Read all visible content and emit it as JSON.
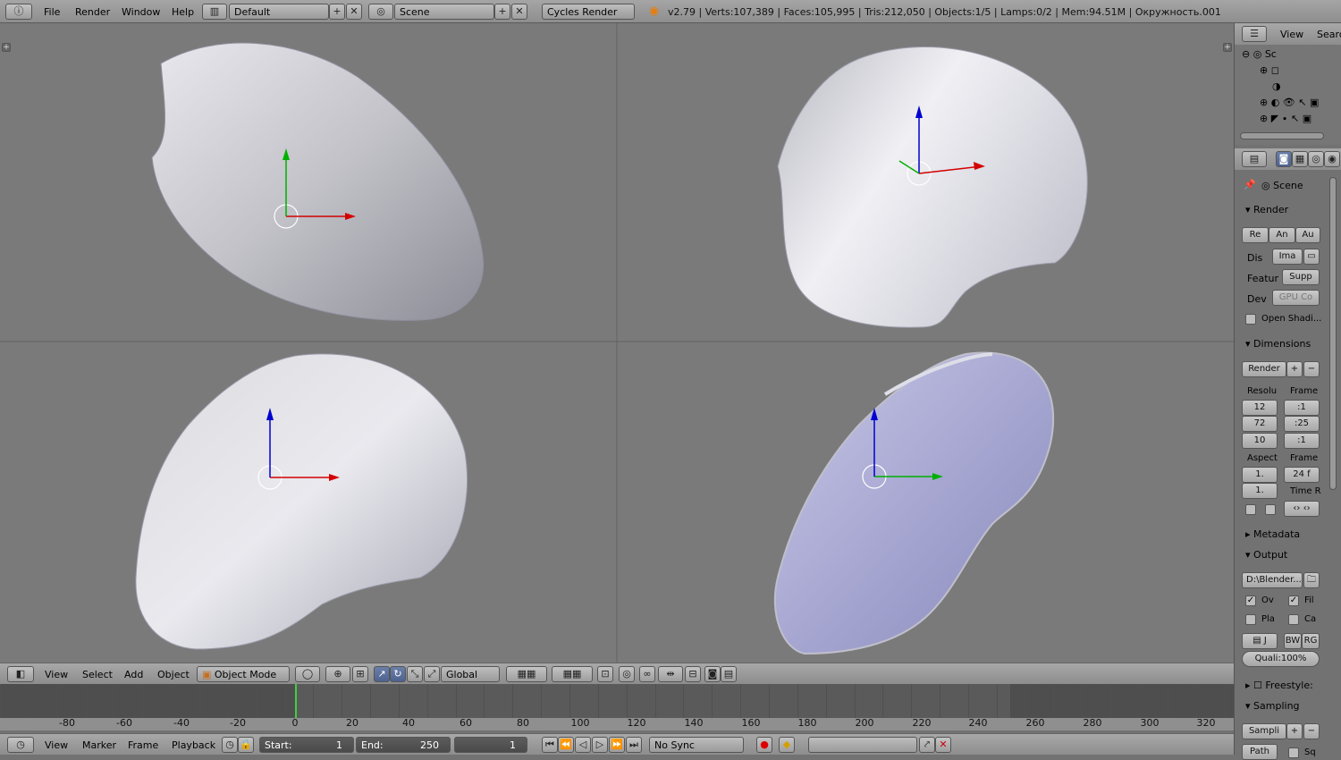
{
  "topbar": {
    "menus": [
      "File",
      "Render",
      "Window",
      "Help"
    ],
    "layout": "Default",
    "scene": "Scene",
    "engine": "Cycles Render",
    "info": "v2.79 | Verts:107,389 | Faces:105,995 | Tris:212,050 | Objects:1/5 | Lamps:0/2 | Mem:94.51M | Окружность.001"
  },
  "view3d_header": {
    "menus": [
      "View",
      "Select",
      "Add",
      "Object"
    ],
    "mode": "Object Mode",
    "orientation": "Global"
  },
  "timeline": {
    "labels": [
      "-80",
      "-60",
      "-40",
      "-20",
      "0",
      "20",
      "40",
      "60",
      "80",
      "100",
      "120",
      "140",
      "160",
      "180",
      "200",
      "220",
      "240",
      "260",
      "280",
      "300",
      "320"
    ],
    "current_frame_label": "0"
  },
  "timeline_header": {
    "menus": [
      "View",
      "Marker",
      "Frame",
      "Playback"
    ],
    "start_label": "Start:",
    "start_value": "1",
    "end_label": "End:",
    "end_value": "250",
    "current": "1",
    "sync": "No Sync"
  },
  "outliner": {
    "view": "View",
    "search": "Searc",
    "scene_short": "Sc"
  },
  "properties": {
    "scene": "Scene",
    "render_panel": "Render",
    "render_btns": [
      "Re",
      "An",
      "Au"
    ],
    "display_label": "Dis",
    "display_value": "Ima",
    "feature_label": "Featur",
    "feature_value": "Supp",
    "device_label": "Dev",
    "device_value": "GPU Co",
    "osl": "Open Shadi...",
    "dimensions": "Dimensions",
    "dim_preset": "Render",
    "resolution": "Resolu",
    "frame_range": "Frame",
    "res_x": "12",
    "res_y": "72",
    "res_pct": "10",
    "frame_start": ":1",
    "frame_end": ":25",
    "frame_step": ":1",
    "aspect": "Aspect",
    "frame_rate": "Frame",
    "aspect_x": "1.",
    "aspect_y": "1.",
    "fps": "24 f",
    "time_remap": "Time R",
    "metadata": "Metadata",
    "output": "Output",
    "output_path": "D:\\Blender...",
    "ov": "Ov",
    "fil": "Fil",
    "pla": "Pla",
    "ca": "Ca",
    "format": "J",
    "bw": "BW",
    "rg": "RG",
    "quality": "Quali:100%",
    "freestyle": "Freestyle:",
    "sampling": "Sampling",
    "sampling_preset": "Sampli",
    "path": "Path",
    "sq": "Sq"
  },
  "colors": {
    "x_axis": "#d40000",
    "y_axis": "#00b000",
    "z_axis": "#0000d0",
    "viewport_bg": "#7a7a7a"
  }
}
